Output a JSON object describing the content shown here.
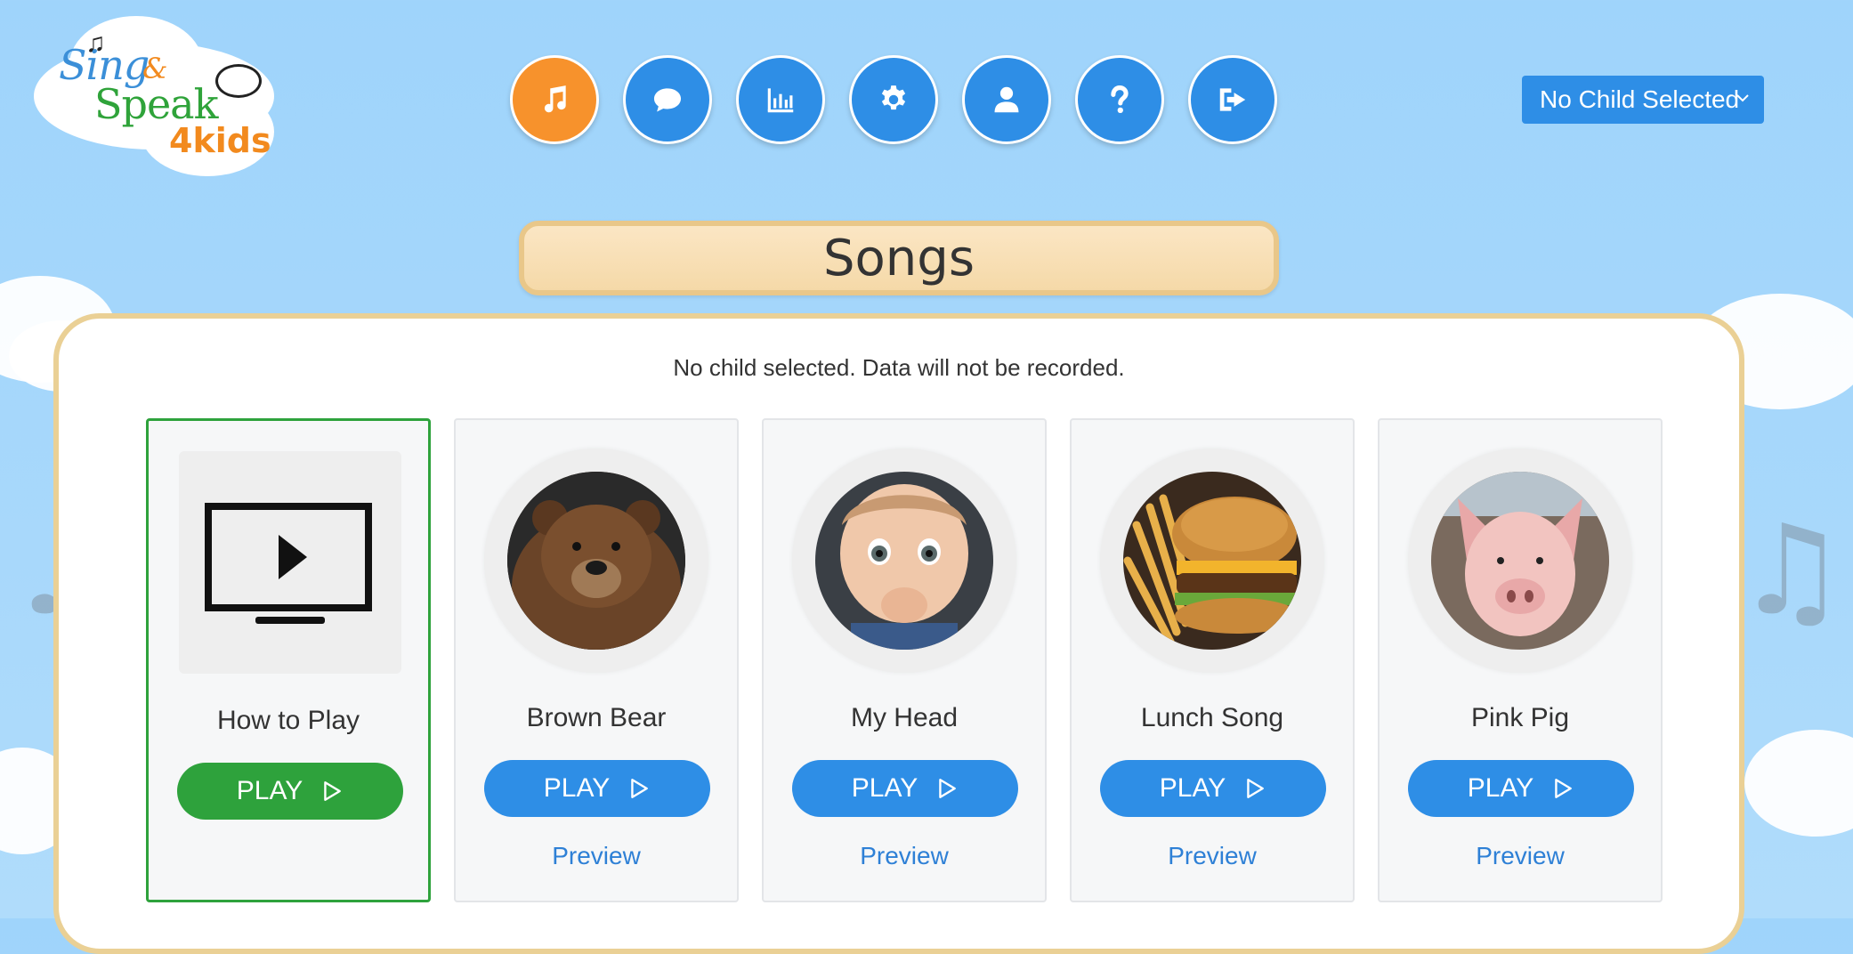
{
  "app": {
    "logo_alt": "Sing & Speak 4kids",
    "logo_sing": "Sing",
    "logo_amp": "&",
    "logo_speak": "Speak",
    "logo_4kids": "4kids"
  },
  "nav": [
    {
      "name": "songs",
      "icon": "music-icon",
      "active": true
    },
    {
      "name": "chat",
      "icon": "chat-bubble-icon"
    },
    {
      "name": "stats",
      "icon": "bar-chart-icon"
    },
    {
      "name": "settings",
      "icon": "gear-icon"
    },
    {
      "name": "profile",
      "icon": "user-icon"
    },
    {
      "name": "help",
      "icon": "question-icon"
    },
    {
      "name": "logout",
      "icon": "sign-out-icon"
    }
  ],
  "child_select": {
    "value": "No Child Selected"
  },
  "page": {
    "title": "Songs",
    "status": "No child selected. Data will not be recorded."
  },
  "cards": [
    {
      "title": "How to Play",
      "play_label": "PLAY",
      "image": "tv-play-icon",
      "selected": true
    },
    {
      "title": "Brown Bear",
      "play_label": "PLAY",
      "preview_label": "Preview",
      "image": "brown-bear"
    },
    {
      "title": "My Head",
      "play_label": "PLAY",
      "preview_label": "Preview",
      "image": "baby"
    },
    {
      "title": "Lunch Song",
      "play_label": "PLAY",
      "preview_label": "Preview",
      "image": "burger-fries"
    },
    {
      "title": "Pink Pig",
      "play_label": "PLAY",
      "preview_label": "Preview",
      "image": "pig"
    }
  ],
  "colors": {
    "accent_blue": "#2e8ee6",
    "active_orange": "#f7922c",
    "green": "#2ea23c",
    "title_bg": "#f5d9a8"
  }
}
